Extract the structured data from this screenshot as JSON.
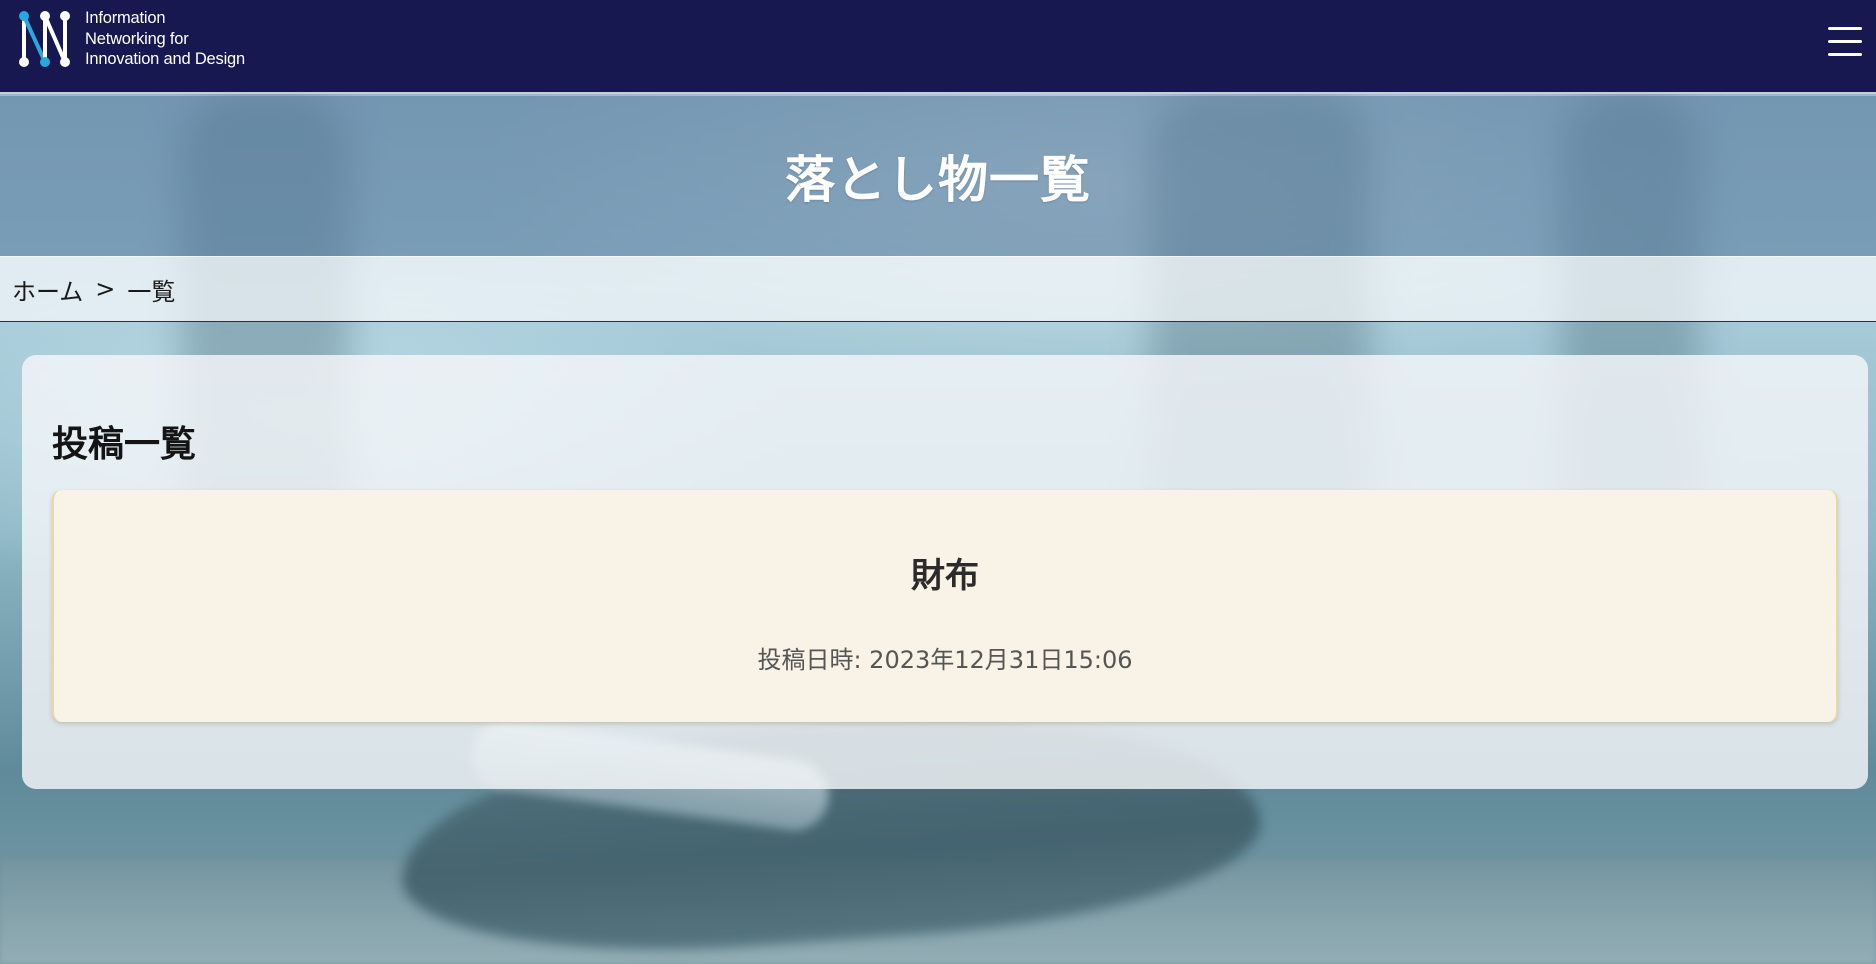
{
  "header": {
    "logo_lines": [
      "Information",
      "Networking for",
      "Innovation and Design"
    ],
    "menu_icon": "hamburger-menu-icon"
  },
  "hero": {
    "title": "落とし物一覧"
  },
  "breadcrumb": {
    "home": "ホーム",
    "separator": ">",
    "current": "一覧"
  },
  "main": {
    "section_title": "投稿一覧",
    "posts": [
      {
        "title": "財布",
        "date_label": "投稿日時: 2023年12月31日15:06"
      }
    ]
  },
  "colors": {
    "header_bg": "#181850",
    "logo_accent": "#29a8e0",
    "card_bg": "#f8f3e6"
  }
}
